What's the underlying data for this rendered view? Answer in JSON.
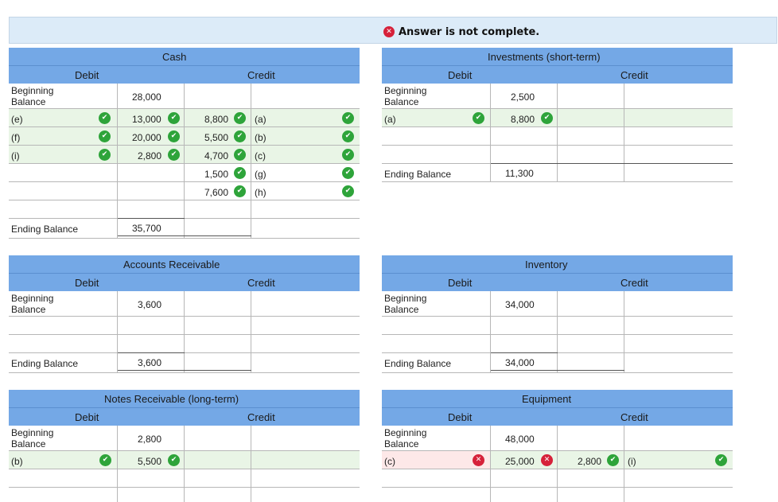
{
  "banner": {
    "message": "Answer is not complete."
  },
  "labels": {
    "debit": "Debit",
    "credit": "Credit",
    "beginning_balance": "Beginning Balance",
    "ending_balance": "Ending Balance"
  },
  "cash": {
    "title": "Cash",
    "beginning": "28,000",
    "debit_rows": [
      {
        "label": "(e)",
        "amount": "13,000"
      },
      {
        "label": "(f)",
        "amount": "20,000"
      },
      {
        "label": "(i)",
        "amount": "2,800"
      }
    ],
    "credit_rows": [
      {
        "amount": "8,800",
        "label": "(a)"
      },
      {
        "amount": "5,500",
        "label": "(b)"
      },
      {
        "amount": "4,700",
        "label": "(c)"
      },
      {
        "amount": "1,500",
        "label": "(g)"
      },
      {
        "amount": "7,600",
        "label": "(h)"
      }
    ],
    "ending": "35,700"
  },
  "investments": {
    "title": "Investments (short-term)",
    "beginning": "2,500",
    "debit_rows": [
      {
        "label": "(a)",
        "amount": "8,800"
      }
    ],
    "ending": "11,300"
  },
  "receivable": {
    "title": "Accounts Receivable",
    "beginning": "3,600",
    "ending": "3,600"
  },
  "inventory": {
    "title": "Inventory",
    "beginning": "34,000",
    "ending": "34,000"
  },
  "notes": {
    "title": "Notes Receivable (long-term)",
    "beginning": "2,800",
    "debit_rows": [
      {
        "label": "(b)",
        "amount": "5,500"
      }
    ]
  },
  "equipment": {
    "title": "Equipment",
    "beginning": "48,000",
    "debit_rows": [
      {
        "label": "(c)",
        "amount": "25,000"
      }
    ],
    "credit_rows": [
      {
        "amount": "2,800",
        "label": "(i)"
      }
    ]
  },
  "icons": {
    "correct": "check-icon",
    "incorrect": "x-icon"
  },
  "colors": {
    "header": "#74a8e6",
    "correct": "#2ea43a",
    "incorrect": "#d6213a",
    "banner": "#dcebf8"
  }
}
